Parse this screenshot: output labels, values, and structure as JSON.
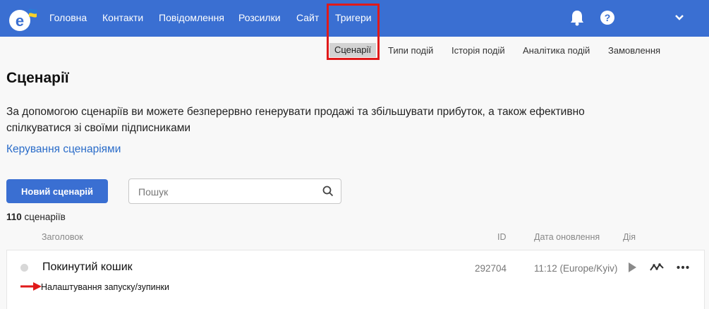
{
  "colors": {
    "brand": "#3a6fd2",
    "link": "#2a6cc9",
    "highlight": "#e01a1a"
  },
  "topnav": {
    "items": [
      "Головна",
      "Контакти",
      "Повідомлення",
      "Розсилки",
      "Сайт",
      "Тригери"
    ],
    "active": "Тригери",
    "icons": [
      "bell-icon",
      "help-icon",
      "chevron-down-icon"
    ],
    "help_glyph": "?"
  },
  "subnav": {
    "items": [
      "Сценарії",
      "Типи подій",
      "Історія подій",
      "Аналітика подій",
      "Замовлення"
    ],
    "active": "Сценарії"
  },
  "page": {
    "title": "Сценарії",
    "description": "За допомогою сценаріїв ви можете безперервно генерувати продажі та збільшувати прибуток, а також ефективно спілкуватися зі своїми підписниками",
    "manage_link": "Керування сценаріями"
  },
  "toolbar": {
    "new_button": "Новий сценарій",
    "search_placeholder": "Пошук"
  },
  "list": {
    "count": "110",
    "count_label": "сценаріїв",
    "columns": [
      "Заголовок",
      "ID",
      "Дата оновлення",
      "Дія"
    ],
    "rows": [
      {
        "title": "Покинутий кошик",
        "id": "292704",
        "updated": "11:12 (Europe/Kyiv)",
        "actions": [
          "play-icon",
          "stats-icon",
          "more-icon"
        ]
      }
    ]
  },
  "annotation": {
    "text": "Налаштування запуску/зупинки"
  }
}
